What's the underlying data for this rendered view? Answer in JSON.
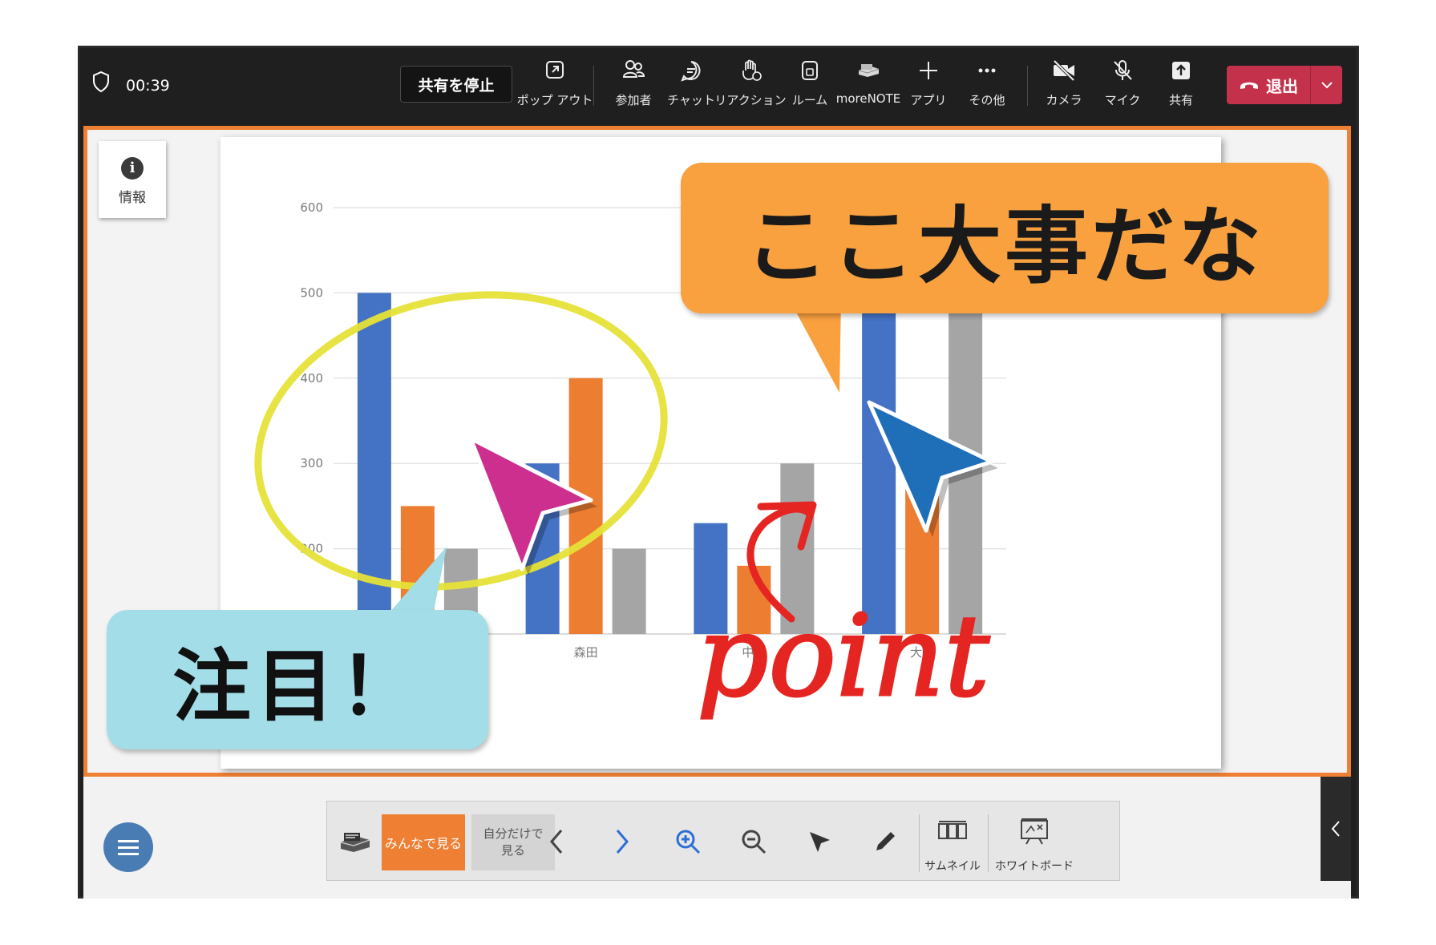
{
  "topbar": {
    "timer": "00:39",
    "stop_share_label": "共有を停止",
    "buttons": [
      {
        "label": "ポップ アウト",
        "icon": "popout-icon"
      },
      {
        "label": "参加者",
        "icon": "people-icon"
      },
      {
        "label": "チャット",
        "icon": "chat-icon"
      },
      {
        "label": "リアクション",
        "icon": "raise-hand-icon"
      },
      {
        "label": "ルーム",
        "icon": "room-icon"
      },
      {
        "label": "moreNOTE",
        "icon": "morenote-icon"
      },
      {
        "label": "アプリ",
        "icon": "plus-icon"
      },
      {
        "label": "その他",
        "icon": "more-icon"
      },
      {
        "label": "カメラ",
        "icon": "camera-off-icon"
      },
      {
        "label": "マイク",
        "icon": "mic-off-icon"
      },
      {
        "label": "共有",
        "icon": "share-icon"
      }
    ],
    "leave_label": "退出"
  },
  "stage": {
    "info_label": "情報",
    "bubble_top": "ここ大事だな",
    "bubble_bottom": "注目！",
    "handwriting": "point"
  },
  "chart_data": {
    "type": "bar",
    "categories": [
      "",
      "森田",
      "中村",
      "大川"
    ],
    "series": [
      {
        "values": [
          500,
          300,
          230,
          480
        ],
        "color": "#4472c4"
      },
      {
        "values": [
          250,
          400,
          180,
          280
        ],
        "color": "#ed7d31"
      },
      {
        "values": [
          200,
          200,
          300,
          490
        ],
        "color": "#a5a5a5"
      }
    ],
    "y_ticks": [
      "200",
      "300",
      "400",
      "500",
      "600"
    ],
    "ylim": [
      100,
      600
    ],
    "grid": true
  },
  "bottom": {
    "everyone_label": "みんなで見る",
    "self_label_1": "自分だけで",
    "self_label_2": "見る",
    "thumbnail_label": "サムネイル",
    "whiteboard_label": "ホワイトボード"
  },
  "colors": {
    "accent_orange": "#ee7f33",
    "leave_red": "#c4314b",
    "bubble_orange": "#f9a03f",
    "bubble_blue": "#a2dde8",
    "menu_blue": "#4a7cb4"
  }
}
